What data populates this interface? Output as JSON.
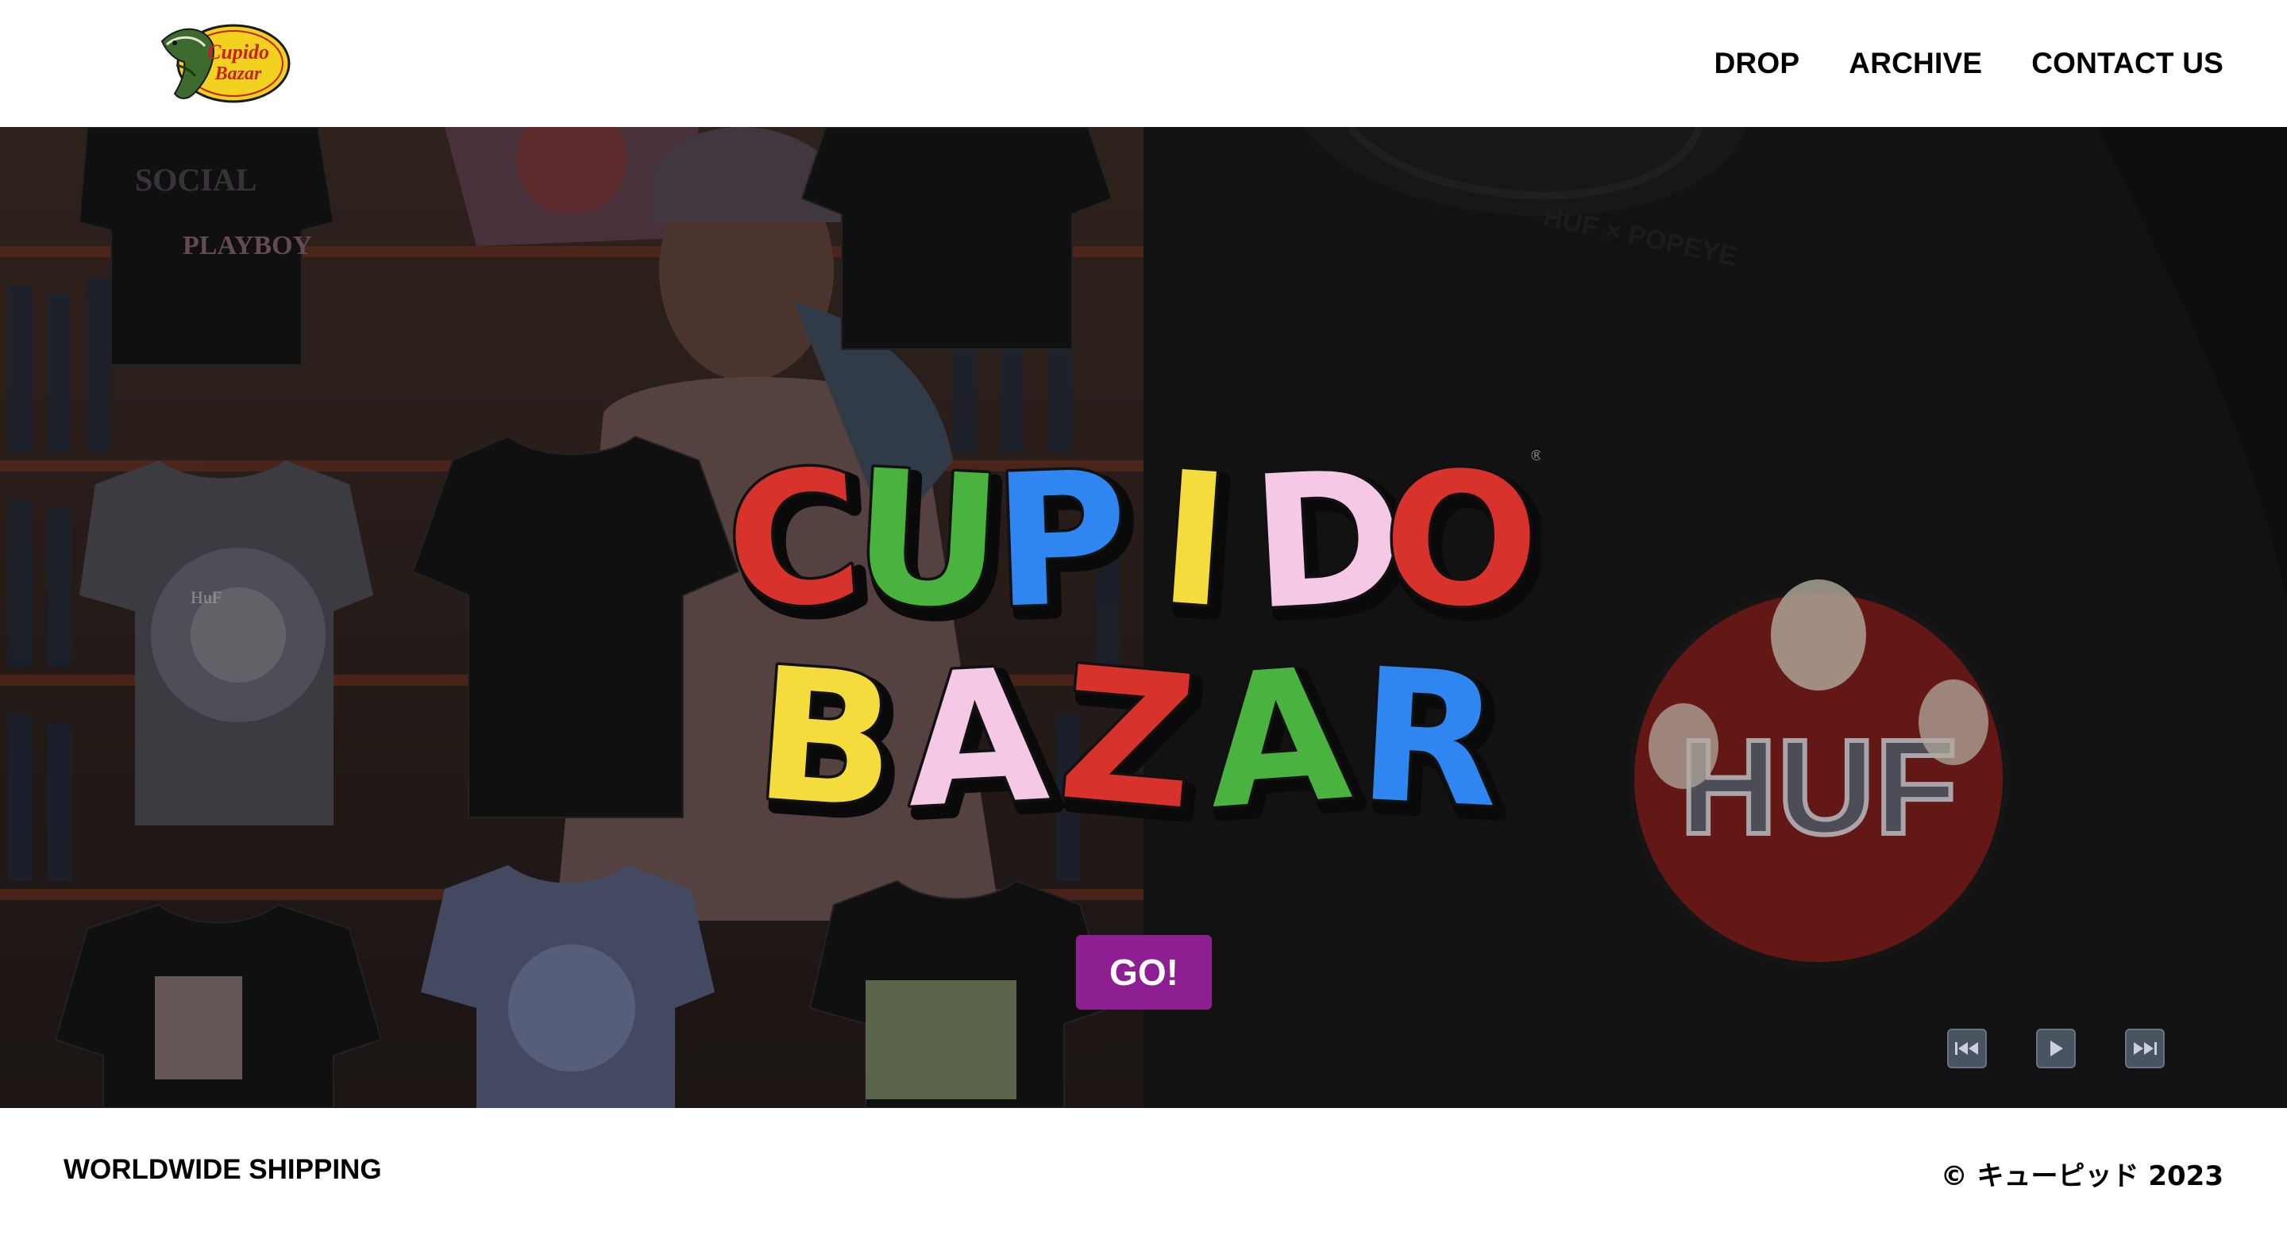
{
  "header": {
    "logo_text": [
      "Cupido",
      "Bazar"
    ],
    "nav": [
      {
        "label": "DROP"
      },
      {
        "label": "ARCHIVE"
      },
      {
        "label": "CONTACT US"
      }
    ]
  },
  "hero": {
    "title_line1": [
      "C",
      "U",
      "P",
      "I",
      "D",
      "O"
    ],
    "title_line2": [
      "B",
      "A",
      "Z",
      "A",
      "R"
    ],
    "title_colors": {
      "red": "#d8322c",
      "green": "#4ab23f",
      "blue": "#2f86f0",
      "yellow": "#f4dc3c",
      "pink": "#f5c8e6"
    },
    "go_label": "GO!",
    "go_color": "#8e1f93",
    "controls": [
      {
        "icon": "previous-icon"
      },
      {
        "icon": "play-icon"
      },
      {
        "icon": "next-icon"
      }
    ]
  },
  "footer": {
    "left": "WORLDWIDE SHIPPING",
    "right": "© キューピッド 2023"
  }
}
